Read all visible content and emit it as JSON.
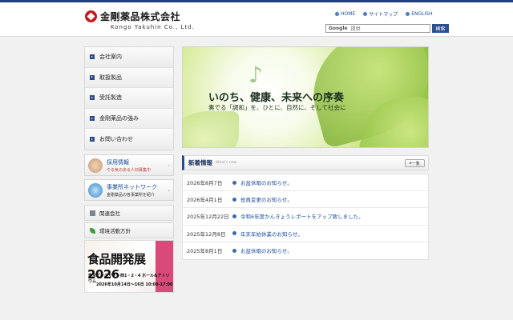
{
  "header": {
    "company_name": "金剛薬品株式会社",
    "company_name_en": "Kongo Yakuhin Co., Ltd.",
    "links": [
      {
        "label": "HOME",
        "icon": "circle-arrow-icon"
      },
      {
        "label": "サイトマップ",
        "icon": "circle-arrow-icon"
      },
      {
        "label": "ENGLISH",
        "icon": "circle-arrow-icon"
      }
    ],
    "search": {
      "brand": "Google",
      "placeholder": "提供",
      "button": "検索"
    }
  },
  "sidebar": {
    "items": [
      {
        "label": "会社案内"
      },
      {
        "label": "取扱製品"
      },
      {
        "label": "受託製造"
      },
      {
        "label": "金剛薬品の強み"
      },
      {
        "label": "お問い合わせ"
      }
    ],
    "banners": [
      {
        "title": "採用情報",
        "subtitle": "やる気のある人材募集中"
      },
      {
        "title": "事業所ネットワーク",
        "subtitle": "金剛薬品の各事業所を紹介"
      }
    ],
    "links": [
      {
        "label": "関連会社"
      },
      {
        "label": "環境活動方針"
      }
    ],
    "expo": {
      "title": "食品開発展2026",
      "line1": "東京ビッグサイト西1・2・4 ホール&アトリウム",
      "line2": "2026年10月14日～16日 10:00-17:00"
    }
  },
  "hero": {
    "title": "いのち、健康、未来への序奏",
    "subtitle": "奏でる「調和」を、ひとに、自然に、そして社会に"
  },
  "news": {
    "title": "新着情報",
    "title_en": "What's new",
    "list_button": "一覧",
    "items": [
      {
        "date": "2026年8月7日",
        "text": "お盆休暇のお知らせ。"
      },
      {
        "date": "2026年4月1日",
        "text": "役員変更のお知らせ。"
      },
      {
        "date": "2025年12月22日",
        "text": "令和6年度かんきょうレポートをアップ致しました。"
      },
      {
        "date": "2025年12月8日",
        "text": "年末年始休業のお知らせ。"
      },
      {
        "date": "2025年8月1日",
        "text": "お盆休暇のお知らせ。"
      }
    ]
  }
}
